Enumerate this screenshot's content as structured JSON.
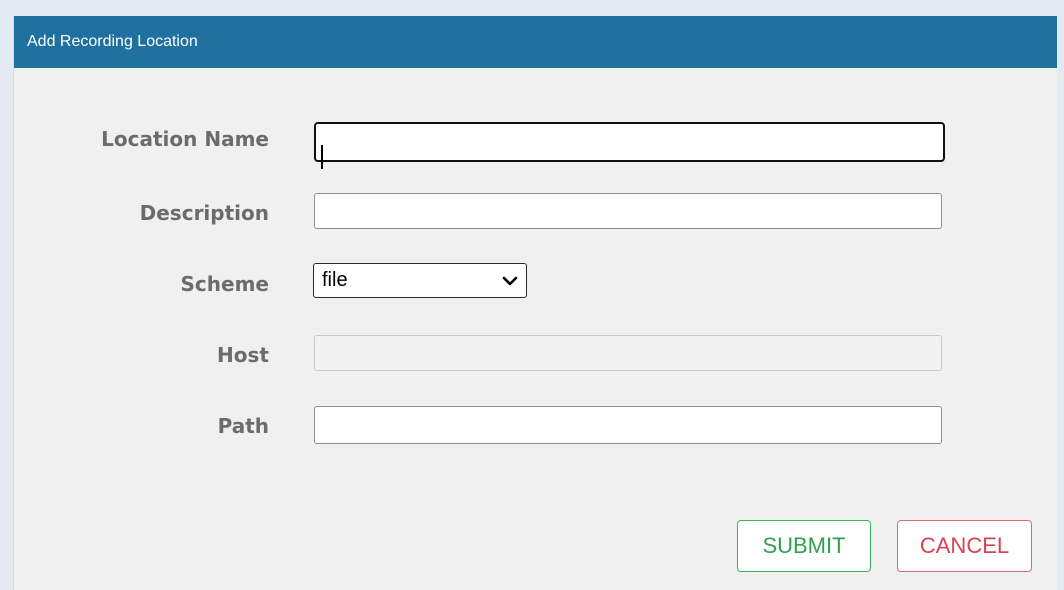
{
  "dialog": {
    "title": "Add Recording Location"
  },
  "form": {
    "location_name": {
      "label": "Location Name",
      "value": ""
    },
    "description": {
      "label": "Description",
      "value": ""
    },
    "scheme": {
      "label": "Scheme",
      "selected": "file"
    },
    "host": {
      "label": "Host",
      "value": ""
    },
    "path": {
      "label": "Path",
      "value": ""
    }
  },
  "buttons": {
    "submit": "SUBMIT",
    "cancel": "CANCEL"
  },
  "colors": {
    "header": "#20709f",
    "submit": "#2ea14f",
    "cancel": "#d8434f"
  },
  "icons": {
    "select_arrow": "chevron-down-icon"
  }
}
